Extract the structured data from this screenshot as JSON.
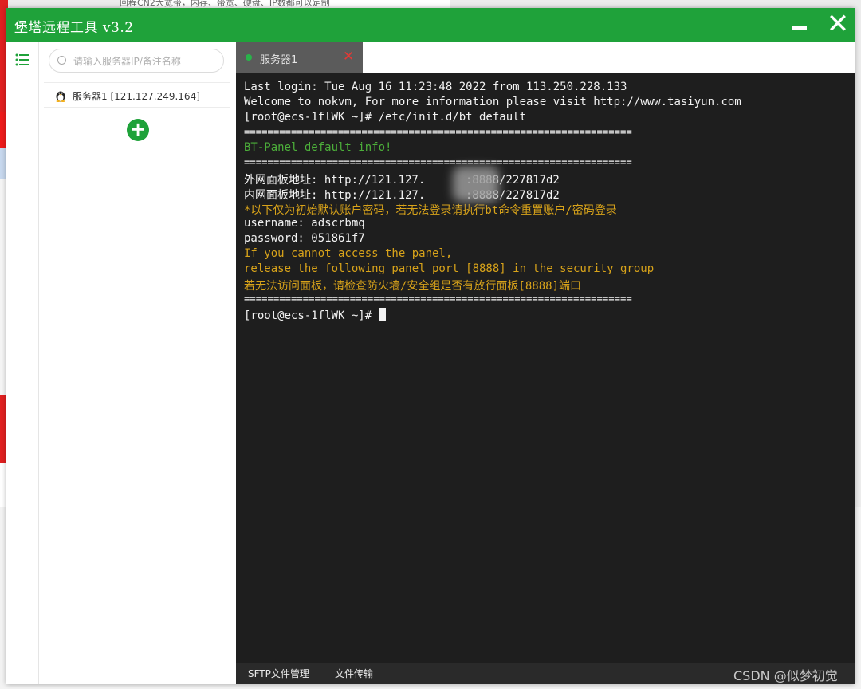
{
  "background": {
    "top_banner_text": "回程CN2大宽带，内存、带宽、硬盘、IP数都可以定制"
  },
  "window": {
    "title": "堡塔远程工具 v3.2",
    "minimize_icon": "minimize-icon",
    "close_icon": "close-icon"
  },
  "rail": {
    "list_icon": "list-icon"
  },
  "sidebar": {
    "search_placeholder": "请输入服务器IP/备注名称",
    "servers": [
      {
        "label": "服务器1 [121.127.249.164]",
        "icon": "linux-tux-icon"
      }
    ],
    "add_icon": "plus-icon"
  },
  "tabs": [
    {
      "label": "服务器1",
      "status": "connected",
      "status_color": "#29b34a"
    }
  ],
  "terminal": {
    "lines": [
      {
        "text": "Last login: Tue Aug 16 11:23:48 2022 from 113.250.228.133",
        "style": "normal"
      },
      {
        "text": "Welcome to nokvm, For more information please visit http://www.tasiyun.com",
        "style": "normal"
      },
      {
        "text": "[root@ecs-1flWK ~]# /etc/init.d/bt default",
        "style": "normal"
      },
      {
        "text": "==================================================================",
        "style": "normal"
      },
      {
        "text": "BT-Panel default info!",
        "style": "green"
      },
      {
        "text": "==================================================================",
        "style": "normal"
      },
      {
        "text": "外网面板地址: http://121.127.      :8888/227817d2",
        "style": "normal"
      },
      {
        "text": "内网面板地址: http://121.127.      :8888/227817d2",
        "style": "normal"
      },
      {
        "text": "*以下仅为初始默认账户密码，若无法登录请执行bt命令重置账户/密码登录",
        "style": "orange"
      },
      {
        "text": "username: adscrbmq",
        "style": "normal"
      },
      {
        "text": "password: 051861f7",
        "style": "normal"
      },
      {
        "text": "If you cannot access the panel,",
        "style": "orange"
      },
      {
        "text": "release the following panel port [8888] in the security group",
        "style": "orange"
      },
      {
        "text": "若无法访问面板，请检查防火墙/安全组是否有放行面板[8888]端口",
        "style": "orange"
      },
      {
        "text": "==================================================================",
        "style": "normal"
      },
      {
        "text": "[root@ecs-1flWK ~]# ",
        "style": "normal"
      }
    ]
  },
  "bottom_bar": {
    "sftp_label": "SFTP文件管理",
    "transfer_label": "文件传输"
  },
  "watermark": "CSDN @似梦初觉",
  "colors": {
    "accent_green": "#1fa23a",
    "terminal_bg": "#1e1e1e",
    "terminal_green": "#4caf3a",
    "terminal_orange": "#d8a31a"
  }
}
